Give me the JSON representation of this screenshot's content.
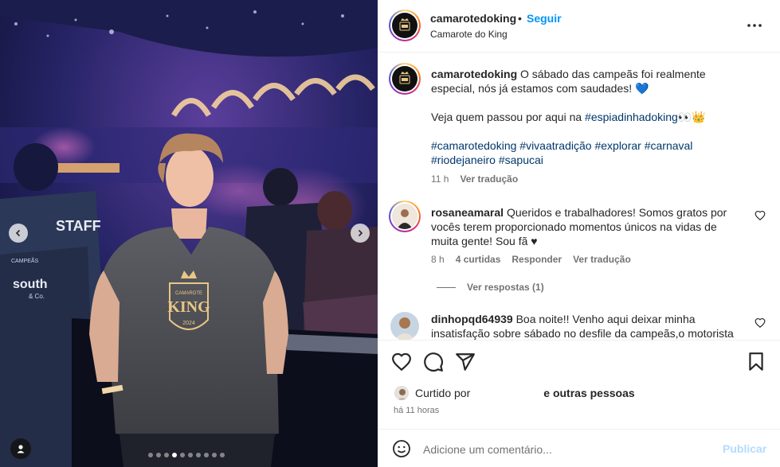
{
  "post": {
    "username": "camarotedoking",
    "follow_label": "Seguir",
    "separator": "•",
    "location": "Camarote do King"
  },
  "media": {
    "shirt_text_top": "CAMAROTE",
    "shirt_text_main": "KING",
    "shirt_text_year": "2024",
    "bg_text_staff": "STAFF",
    "bg_text_brand": "south",
    "bg_text_brand_sub": "& Co.",
    "bg_text_campeas": "CAMPEÃS",
    "carousel_total": 10,
    "carousel_active": 3
  },
  "caption": {
    "username": "camarotedoking",
    "line1": "O sábado das campeãs foi realmente especial, nós já estamos com saudades! 💙",
    "line2_prefix": "Veja quem passou por aqui na ",
    "line2_tag": "#espiadinhadoking",
    "line2_emoji": "👀👑",
    "hashtags": "#camarotedoking #vivaatradição #explorar #carnaval #riodejaneiro #sapucai",
    "time": "11 h",
    "translate": "Ver tradução"
  },
  "comments": [
    {
      "username": "rosaneamaral",
      "text": "Queridos e trabalhadores! Somos gratos por vocês terem proporcionado momentos únicos na vidas de muita gente! Sou fã ♥",
      "time": "8 h",
      "likes": "4 curtidas",
      "reply": "Responder",
      "translate": "Ver tradução",
      "view_replies": "Ver respostas (1)"
    },
    {
      "username": "dinhopqd64939",
      "text": "Boa noite!! Venho aqui deixar minha insatisfação sobre sábado no desfile da campeãs,o motorista"
    }
  ],
  "footer": {
    "liked_prefix": "Curtido por",
    "liked_suffix": "e outras pessoas",
    "time_ago": "há 11 horas",
    "comment_placeholder": "Adicione um comentário...",
    "publish_label": "Publicar"
  },
  "colors": {
    "accent": "#0095f6",
    "link": "#00376b",
    "muted": "#737373",
    "publish_disabled": "#b3dbff"
  }
}
